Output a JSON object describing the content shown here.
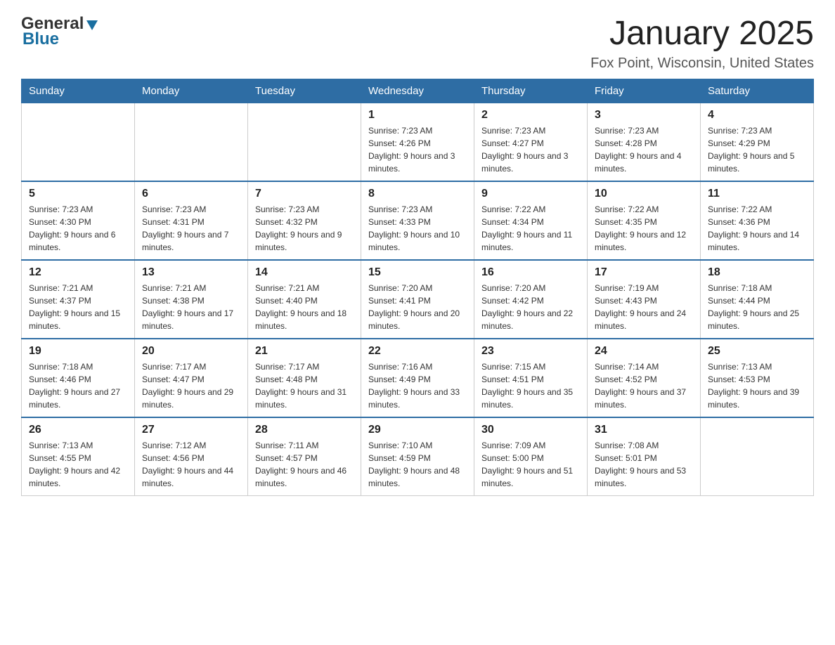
{
  "header": {
    "logo_general": "General",
    "logo_blue": "Blue",
    "month_title": "January 2025",
    "location": "Fox Point, Wisconsin, United States"
  },
  "days_of_week": [
    "Sunday",
    "Monday",
    "Tuesday",
    "Wednesday",
    "Thursday",
    "Friday",
    "Saturday"
  ],
  "weeks": [
    [
      {
        "day": "",
        "info": ""
      },
      {
        "day": "",
        "info": ""
      },
      {
        "day": "",
        "info": ""
      },
      {
        "day": "1",
        "info": "Sunrise: 7:23 AM\nSunset: 4:26 PM\nDaylight: 9 hours and 3 minutes."
      },
      {
        "day": "2",
        "info": "Sunrise: 7:23 AM\nSunset: 4:27 PM\nDaylight: 9 hours and 3 minutes."
      },
      {
        "day": "3",
        "info": "Sunrise: 7:23 AM\nSunset: 4:28 PM\nDaylight: 9 hours and 4 minutes."
      },
      {
        "day": "4",
        "info": "Sunrise: 7:23 AM\nSunset: 4:29 PM\nDaylight: 9 hours and 5 minutes."
      }
    ],
    [
      {
        "day": "5",
        "info": "Sunrise: 7:23 AM\nSunset: 4:30 PM\nDaylight: 9 hours and 6 minutes."
      },
      {
        "day": "6",
        "info": "Sunrise: 7:23 AM\nSunset: 4:31 PM\nDaylight: 9 hours and 7 minutes."
      },
      {
        "day": "7",
        "info": "Sunrise: 7:23 AM\nSunset: 4:32 PM\nDaylight: 9 hours and 9 minutes."
      },
      {
        "day": "8",
        "info": "Sunrise: 7:23 AM\nSunset: 4:33 PM\nDaylight: 9 hours and 10 minutes."
      },
      {
        "day": "9",
        "info": "Sunrise: 7:22 AM\nSunset: 4:34 PM\nDaylight: 9 hours and 11 minutes."
      },
      {
        "day": "10",
        "info": "Sunrise: 7:22 AM\nSunset: 4:35 PM\nDaylight: 9 hours and 12 minutes."
      },
      {
        "day": "11",
        "info": "Sunrise: 7:22 AM\nSunset: 4:36 PM\nDaylight: 9 hours and 14 minutes."
      }
    ],
    [
      {
        "day": "12",
        "info": "Sunrise: 7:21 AM\nSunset: 4:37 PM\nDaylight: 9 hours and 15 minutes."
      },
      {
        "day": "13",
        "info": "Sunrise: 7:21 AM\nSunset: 4:38 PM\nDaylight: 9 hours and 17 minutes."
      },
      {
        "day": "14",
        "info": "Sunrise: 7:21 AM\nSunset: 4:40 PM\nDaylight: 9 hours and 18 minutes."
      },
      {
        "day": "15",
        "info": "Sunrise: 7:20 AM\nSunset: 4:41 PM\nDaylight: 9 hours and 20 minutes."
      },
      {
        "day": "16",
        "info": "Sunrise: 7:20 AM\nSunset: 4:42 PM\nDaylight: 9 hours and 22 minutes."
      },
      {
        "day": "17",
        "info": "Sunrise: 7:19 AM\nSunset: 4:43 PM\nDaylight: 9 hours and 24 minutes."
      },
      {
        "day": "18",
        "info": "Sunrise: 7:18 AM\nSunset: 4:44 PM\nDaylight: 9 hours and 25 minutes."
      }
    ],
    [
      {
        "day": "19",
        "info": "Sunrise: 7:18 AM\nSunset: 4:46 PM\nDaylight: 9 hours and 27 minutes."
      },
      {
        "day": "20",
        "info": "Sunrise: 7:17 AM\nSunset: 4:47 PM\nDaylight: 9 hours and 29 minutes."
      },
      {
        "day": "21",
        "info": "Sunrise: 7:17 AM\nSunset: 4:48 PM\nDaylight: 9 hours and 31 minutes."
      },
      {
        "day": "22",
        "info": "Sunrise: 7:16 AM\nSunset: 4:49 PM\nDaylight: 9 hours and 33 minutes."
      },
      {
        "day": "23",
        "info": "Sunrise: 7:15 AM\nSunset: 4:51 PM\nDaylight: 9 hours and 35 minutes."
      },
      {
        "day": "24",
        "info": "Sunrise: 7:14 AM\nSunset: 4:52 PM\nDaylight: 9 hours and 37 minutes."
      },
      {
        "day": "25",
        "info": "Sunrise: 7:13 AM\nSunset: 4:53 PM\nDaylight: 9 hours and 39 minutes."
      }
    ],
    [
      {
        "day": "26",
        "info": "Sunrise: 7:13 AM\nSunset: 4:55 PM\nDaylight: 9 hours and 42 minutes."
      },
      {
        "day": "27",
        "info": "Sunrise: 7:12 AM\nSunset: 4:56 PM\nDaylight: 9 hours and 44 minutes."
      },
      {
        "day": "28",
        "info": "Sunrise: 7:11 AM\nSunset: 4:57 PM\nDaylight: 9 hours and 46 minutes."
      },
      {
        "day": "29",
        "info": "Sunrise: 7:10 AM\nSunset: 4:59 PM\nDaylight: 9 hours and 48 minutes."
      },
      {
        "day": "30",
        "info": "Sunrise: 7:09 AM\nSunset: 5:00 PM\nDaylight: 9 hours and 51 minutes."
      },
      {
        "day": "31",
        "info": "Sunrise: 7:08 AM\nSunset: 5:01 PM\nDaylight: 9 hours and 53 minutes."
      },
      {
        "day": "",
        "info": ""
      }
    ]
  ]
}
